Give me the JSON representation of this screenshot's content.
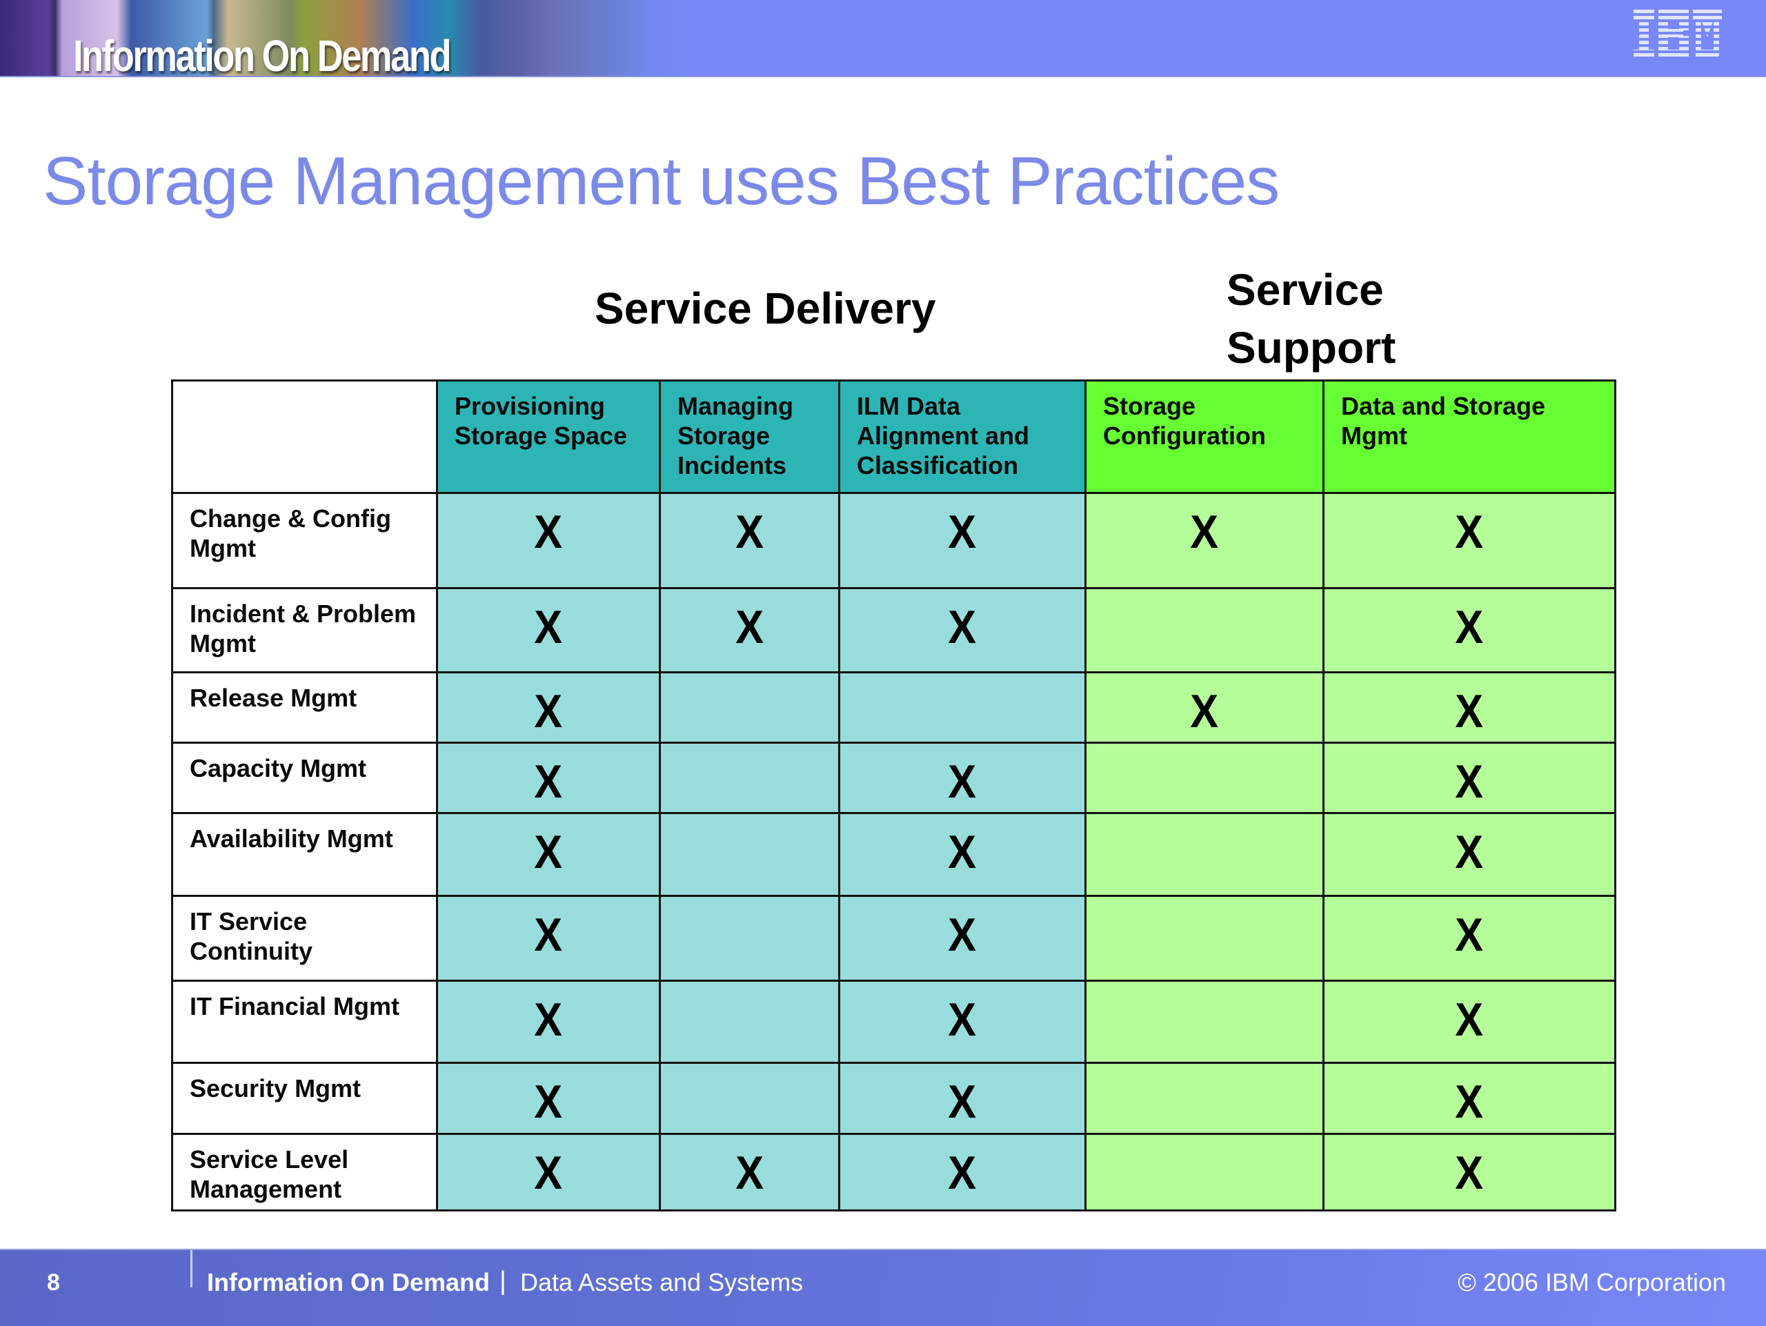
{
  "banner": {
    "title": "Information On Demand",
    "logo": "IBM",
    "logo_icon": "ibm-logo-icon",
    "color": "#7888f8"
  },
  "slide": {
    "title": "Storage Management uses Best Practices",
    "title_color": "#7b8ae8"
  },
  "groups": {
    "delivery": "Service Delivery",
    "support": "Service Support",
    "delivery_header_color": "#2db5b5",
    "delivery_cell_color": "#99dcdc",
    "support_header_color": "#66ff33",
    "support_cell_color": "#b4ff99"
  },
  "table": {
    "mark": "X",
    "columns": [
      {
        "label": "Provisioning Storage Space",
        "group": "Service Delivery"
      },
      {
        "label": "Managing Storage Incidents",
        "group": "Service Delivery"
      },
      {
        "label": "ILM Data Alignment and Classification",
        "group": "Service Delivery"
      },
      {
        "label": "Storage Configuration",
        "group": "Service Support"
      },
      {
        "label": "Data and Storage Mgmt",
        "group": "Service Support"
      }
    ],
    "rows": [
      {
        "label": "Change & Config Mgmt",
        "marks": [
          true,
          true,
          true,
          true,
          true
        ]
      },
      {
        "label": "Incident & Problem Mgmt",
        "marks": [
          true,
          true,
          true,
          false,
          true
        ]
      },
      {
        "label": "Release Mgmt",
        "marks": [
          true,
          false,
          false,
          true,
          true
        ]
      },
      {
        "label": "Capacity Mgmt",
        "marks": [
          true,
          false,
          true,
          false,
          true
        ]
      },
      {
        "label": "Availability Mgmt",
        "marks": [
          true,
          false,
          true,
          false,
          true
        ]
      },
      {
        "label": "IT Service Continuity",
        "marks": [
          true,
          false,
          true,
          false,
          true
        ]
      },
      {
        "label": "IT Financial Mgmt",
        "marks": [
          true,
          false,
          true,
          false,
          true
        ]
      },
      {
        "label": "Security Mgmt",
        "marks": [
          true,
          false,
          true,
          false,
          true
        ]
      },
      {
        "label": "Service Level Management",
        "marks": [
          true,
          true,
          true,
          false,
          true
        ]
      }
    ]
  },
  "footer": {
    "page_number": "8",
    "brand": "Information On Demand",
    "separator": "|",
    "subtitle": "Data Assets and Systems",
    "copyright": "© 2006 IBM Corporation"
  }
}
